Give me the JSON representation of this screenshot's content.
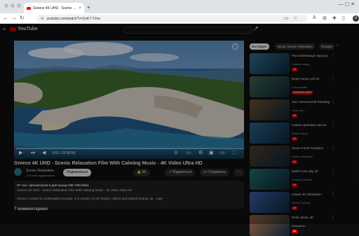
{
  "browser": {
    "tab_title": "Greece 4K UHD - Scenic Rel",
    "tab_close": "×",
    "new_tab": "+",
    "url": "youtube.com/watch?v=UvK7-Y2ve",
    "avatar_letter": "d",
    "window_controls": "—  ▢  ✕"
  },
  "youtube": {
    "logo_text": "YouTube"
  },
  "player": {
    "time": "0:01 / 23:50:55",
    "progress_fraction": 0.01
  },
  "video": {
    "title": "Greece 4K UHD - Scenic Relaxation Film With Calming Music - 4K Video Ultra HD",
    "channel": "Scenic Relaxation",
    "subscribers": "1,34 млн подписчиков",
    "subscribe_label": "Подписаться",
    "likes": "5K",
    "share_label": "Поделиться",
    "save_label": "Сохранить",
    "more": "···",
    "desc_line1": "37 тыс. просмотров  6 дня назад  #4K #4KVideo",
    "desc_line2": "Greece 4K UHD - Scenic Relaxation Film With Calming Music - 4K Video Ultra HD",
    "desc_line3": "Greece, located in southeastern Europe, is a country of rich history, culture and natural beauty, as ...ещё",
    "comments_title": "7 комментариев"
  },
  "sidebar": {
    "chips": [
      "Все видео",
      "Автор: Scenic Relaxation",
      "Похожи"
    ],
    "recs": [
      {
        "title": "Расслабляющая музыка",
        "meta": "Сияние звезд",
        "badge": "4K"
      },
      {
        "title": "Deep Focus Lofi 4K",
        "meta": "Focus Beats",
        "badge": "ПРЯМОЙ ЭФИР"
      },
      {
        "title": "Jazz Instrumental Relaxing",
        "meta": "Cozy Jazz",
        "badge": "4K"
      },
      {
        "title": "Самые красивые места",
        "meta": "Relax Nature",
        "badge": "4K"
      },
      {
        "title": "Snow Forest Fireplace",
        "meta": "Winter Ambience",
        "badge": "4K"
      },
      {
        "title": "Earth From Sky 4K",
        "meta": "Amazing Places",
        "badge": "4K"
      },
      {
        "title": "Hawaii 4K Relaxation",
        "meta": "Ocean Sounds",
        "badge": "4K"
      },
      {
        "title": "Relax Music 4K",
        "meta": "Relaxation",
        "badge": "4K"
      }
    ]
  },
  "colors": {
    "accent": "#ff0000",
    "page_bg": "#0f0f0f"
  }
}
